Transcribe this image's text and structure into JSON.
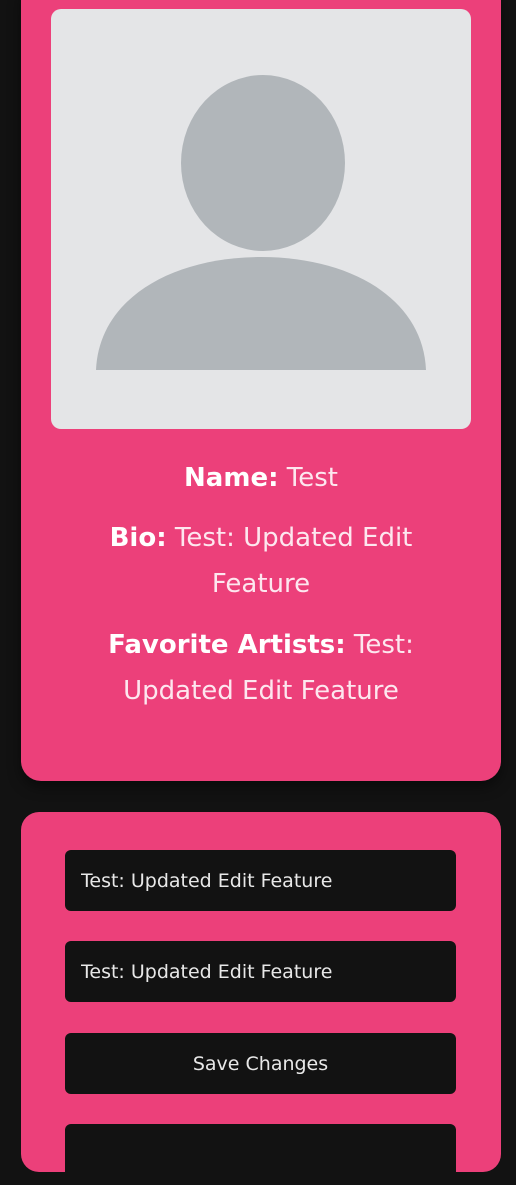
{
  "profile": {
    "avatar_icon": "default-user-avatar-icon",
    "name_label": "Name:",
    "name_value": "Test",
    "bio_label": "Bio:",
    "bio_value": "Test: Updated Edit Feature",
    "artists_label": "Favorite Artists:",
    "artists_value": "Test: Updated Edit Feature"
  },
  "edit_form": {
    "bio_input_value": "Test: Updated Edit Feature",
    "artists_input_value": "Test: Updated Edit Feature",
    "save_label": "Save Changes",
    "extra_label": ""
  },
  "colors": {
    "background": "#121212",
    "card": "#ec407a",
    "avatar_bg": "#e4e5e7",
    "avatar_fg": "#b1b6ba",
    "field_bg": "#121212"
  }
}
